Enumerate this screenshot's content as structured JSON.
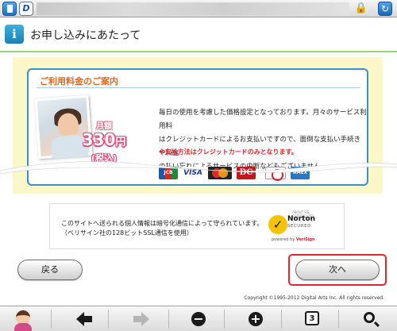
{
  "browser": {
    "favicon_letter": "D",
    "lock_icon": "lock-icon",
    "reload_icon": "reload-icon"
  },
  "header": {
    "title": "お申し込みにあたって",
    "icon_letter": "i"
  },
  "card": {
    "title": "ご利用料金のご案内",
    "price_month": "月額",
    "price_amount": "330",
    "price_unit": "円",
    "price_tax": "(税込)",
    "desc_lines": [
      "毎日の使用を考慮した価格設定となっております。月々のサービス利用料",
      "はクレジットカードによるお支払いですので、面倒な支払い手続きや料金",
      "の払い忘れによるサービスの中断などもございません。"
    ],
    "note": "※支払方法はクレジットカードのみとなります。",
    "card_brands": [
      "JCB",
      "VISA",
      "MasterCard",
      "DC",
      "Diners",
      "AMEX"
    ]
  },
  "ssl": {
    "line1": "このサイトへ送られる個人情報は暗号化通信によって守られています。",
    "line2": "（ベリサイン社の128ビットSSL通信を使用）",
    "norton_name": "Norton",
    "norton_sub": "SECURED",
    "norton_by_prefix": "powered by",
    "norton_by_brand": "VeriSign",
    "norton_top": "ABOUT SSL CERTIFICATES"
  },
  "buttons": {
    "back": "戻る",
    "next": "次へ"
  },
  "footer": {
    "copyright": "Copyright ©1995-2012 Digital Arts Inc. All rights reserved."
  },
  "toolbar": {
    "back_glyph": "🡐",
    "forward_glyph": "🡒",
    "zoom_out": "−",
    "zoom_in": "+",
    "tabs_count": "3"
  },
  "colors": {
    "card_border": "#3d8fc4",
    "card_title": "#e0681e",
    "note_red": "#e3262b",
    "panel_bg": "#fbf7c8",
    "highlight": "#e0262d"
  }
}
